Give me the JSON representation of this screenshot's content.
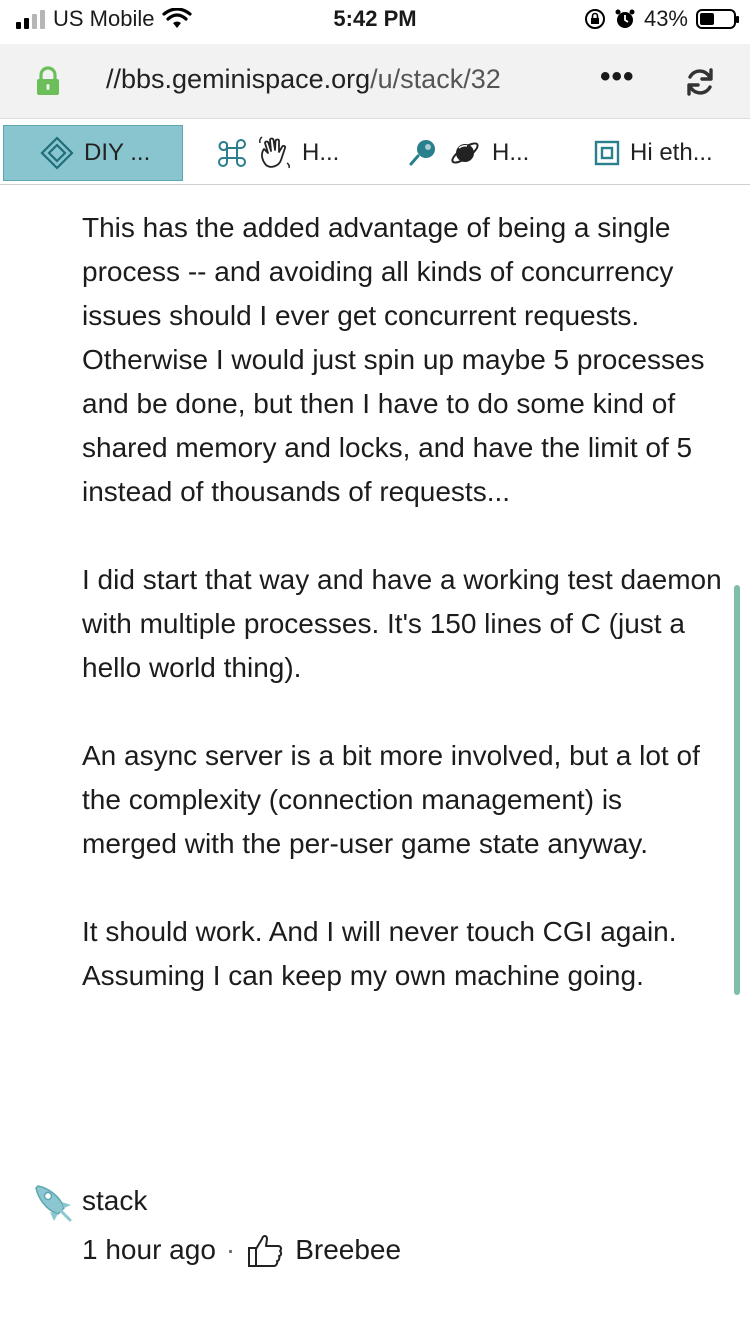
{
  "status_bar": {
    "carrier": "US Mobile",
    "time": "5:42 PM",
    "battery": "43%",
    "battery_level": 0.43,
    "icons": [
      "signal-icon",
      "wifi-icon",
      "rotation-lock-icon",
      "alarm-icon",
      "battery-icon"
    ]
  },
  "url_bar": {
    "url_host": "//bbs.geminispace.org",
    "url_path": "/u/stack/32",
    "more_label": "•••",
    "icons": [
      "lock-icon",
      "more-icon",
      "reload-icon"
    ],
    "lock_color": "#6bbf59"
  },
  "tabs": [
    {
      "label": "DIY ...",
      "icon": "diamond-icon",
      "active": true
    },
    {
      "label": "H...",
      "icon": "command-wave-icon",
      "active": false
    },
    {
      "label": "H...",
      "icon": "comet-planet-icon",
      "active": false
    },
    {
      "label": "Hi eth...",
      "icon": "square-target-icon",
      "active": false
    }
  ],
  "post": {
    "paragraphs": [
      "This has the added advantage of being a single process -- and avoiding all kinds of concurrency issues should I ever get concurrent requests. Otherwise I would just spin up maybe 5 processes and be done, but then I have to do some kind of shared memory and locks, and have the limit of 5 instead of thousands of requests...",
      "I did start that way and have a working test daemon with multiple processes. It's 150 lines of C (just a hello world thing).",
      "An async server is a bit more involved, but a lot of the complexity (connection management) is merged with the per-user game state anyway.",
      "It should work. And I will never touch CGI again. Assuming I can keep my own machine going."
    ]
  },
  "meta": {
    "author": "stack",
    "time_ago": "1 hour ago",
    "separator": "·",
    "reaction_user": "Breebee",
    "icons": [
      "rocket-icon",
      "thumbs-up-icon"
    ]
  },
  "colors": {
    "accent_tab": "#89c5ce",
    "scroll_thumb": "#7fbfa8",
    "tab_icon": "#2a7f8c"
  }
}
